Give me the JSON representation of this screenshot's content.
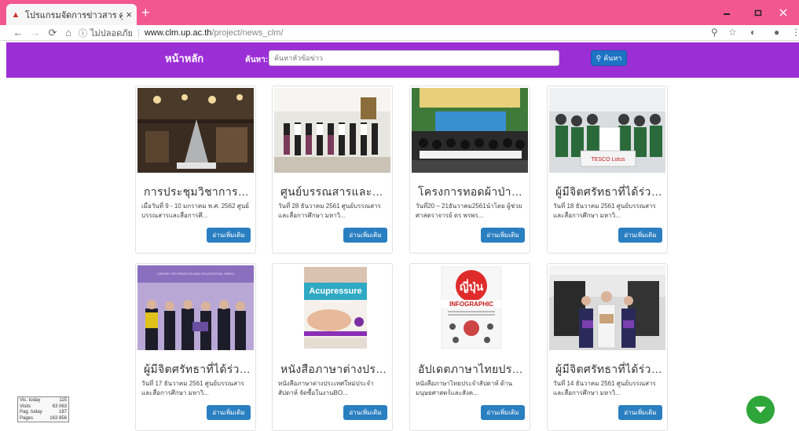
{
  "browser": {
    "tab_title": "โปรแกรมจัดการข่าวสาร ศูนย์บรรณสา",
    "tab_close": "×",
    "new_tab": "+",
    "security_label": "ไม่ปลอดภัย",
    "url_host": "www.clm.up.ac.th",
    "url_path": "/project/news_clm/"
  },
  "header": {
    "home_label": "หน้าหลัก",
    "search_label": "ค้นหา:",
    "search_placeholder": "ค้นหาหัวข้อข่าว",
    "search_button": "ค้นหา"
  },
  "cards": [
    {
      "title": "การประชุมวิชาการระดับชาติ",
      "desc": "เมื่อวันที่ 9 - 10 มกราคม พ.ศ. 2562 ศูนย์บรรณสารและสื่อการศึ...",
      "button": "อ่านเพิ่มเติม"
    },
    {
      "title": "ศูนย์บรรณสารและสื่อการศึกษา",
      "desc": "วันที่ 28 ธันวาคม 2561 ศูนย์บรรณสารและสื่อการศึกษา มหาวิ...",
      "button": "อ่านเพิ่มเติม"
    },
    {
      "title": "โครงการทอดผ้าป่าหนังสือ",
      "desc": "วันที่20 – 21ธันวาคม2561นำโดย ผู้ช่วยศาสตราจารย์ ดร พรพร...",
      "button": "อ่านเพิ่มเติม"
    },
    {
      "title": "ผู้มีจิตศรัทธาที่ได้ร่วมบริจาค",
      "desc": "วันที่ 18 ธันวาคม 2561 ศูนย์บรรณสารและสื่อการศึกษา มหาวิ...",
      "button": "อ่านเพิ่มเติม"
    },
    {
      "title": "ผู้มีจิตศรัทธาที่ได้ร่วมบริจาค",
      "desc": "วันที่ 17 ธันวาคม 2561 ศูนย์บรรณสารและสื่อการศึกษา มหาวิ...",
      "button": "อ่านเพิ่มเติม"
    },
    {
      "title": "หนังสือภาษาต่างประเทศใหม่",
      "desc": "หนังสือภาษาต่างประเทศใหม่ประจำสัปดาห์ จัดซื้อในงานBO...",
      "button": "อ่านเพิ่มเติม"
    },
    {
      "title": "อัปเดตภาษาไทยประจำสัปดาห์",
      "desc": "หนังสือภาษาไทยประจำสัปดาห์ ด้านมนุษยศาสตร์และสังค...",
      "button": "อ่านเพิ่มเติม"
    },
    {
      "title": "ผู้มีจิตศรัทธาที่ได้ร่วมบริจาค",
      "desc": "วันที่ 14 ธันวาคม 2561 ศูนย์บรรณสารและสื่อการศึกษา มหาวิ...",
      "button": "อ่านเพิ่มเติม"
    }
  ],
  "thumb_texts": {
    "c4_banner": "TESCO Lotus",
    "c6_top": "Acupressure",
    "c6_sub": "with Aromatherapy",
    "c7_big": "ญี่ปุ่น",
    "c7_sub": "INFOGRAPHIC",
    "c5_top": "LIBRARY INFORMATION AND EDUCATIONAL MEDIA"
  },
  "stats": [
    {
      "label": "Vis. today",
      "value": "115"
    },
    {
      "label": "Visits",
      "value": "63 063"
    },
    {
      "label": "Pag. today",
      "value": "187"
    },
    {
      "label": "Pages",
      "value": "163 856"
    }
  ],
  "colors": {
    "tabbar": "#f2588f",
    "header": "#9b2fd6",
    "button": "#2a7fc1",
    "fab": "#2fa63a"
  }
}
